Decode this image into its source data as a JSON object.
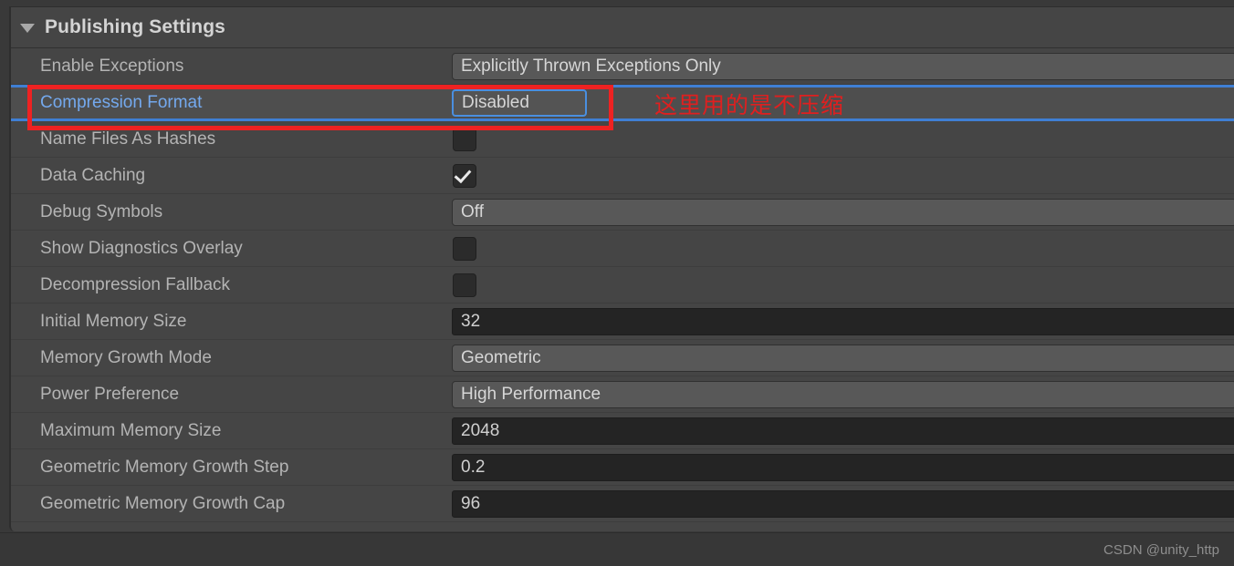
{
  "panel": {
    "foldout": {
      "title": "Publishing Settings",
      "expanded": true,
      "triangle_icon": "chevron-down-icon"
    }
  },
  "rows": [
    {
      "label": "Enable Exceptions",
      "type": "dropdown",
      "value": "Explicitly Thrown Exceptions Only",
      "modified": false,
      "selected": false
    },
    {
      "label": "Compression Format",
      "type": "dropdown",
      "value": "Disabled",
      "modified": true,
      "selected": true
    },
    {
      "label": "Name Files As Hashes",
      "type": "checkbox",
      "value": false,
      "modified": false,
      "selected": false
    },
    {
      "label": "Data Caching",
      "type": "checkbox",
      "value": true,
      "modified": false,
      "selected": false
    },
    {
      "label": "Debug Symbols",
      "type": "dropdown",
      "value": "Off",
      "modified": false,
      "selected": false
    },
    {
      "label": "Show Diagnostics Overlay",
      "type": "checkbox",
      "value": false,
      "modified": false,
      "selected": false
    },
    {
      "label": "Decompression Fallback",
      "type": "checkbox",
      "value": false,
      "modified": false,
      "selected": false
    },
    {
      "label": "Initial Memory Size",
      "type": "number",
      "value": "32",
      "modified": false,
      "selected": false
    },
    {
      "label": "Memory Growth Mode",
      "type": "dropdown",
      "value": "Geometric",
      "modified": false,
      "selected": false
    },
    {
      "label": "Power Preference",
      "type": "dropdown",
      "value": "High Performance",
      "modified": false,
      "selected": false
    },
    {
      "label": "Maximum Memory Size",
      "type": "number",
      "value": "2048",
      "modified": false,
      "selected": false
    },
    {
      "label": "Geometric Memory Growth Step",
      "type": "number",
      "value": "0.2",
      "modified": false,
      "selected": false
    },
    {
      "label": "Geometric Memory Growth Cap",
      "type": "number",
      "value": "96",
      "modified": false,
      "selected": false
    }
  ],
  "annotations": {
    "chinese_note": "这里用的是不压缩",
    "note_color": "#e01f1f",
    "highlight_box_color": "#ee2222"
  },
  "footer": {
    "watermark": "CSDN @unity_http"
  },
  "colors": {
    "panel_bg": "#454545",
    "window_bg": "#393939",
    "selected_row_bg": "#4e4e4e",
    "selection_border": "#3f7fd4",
    "modified_label": "#74a9ee",
    "label_text": "#b4b4b4",
    "dropdown_bg": "#585858",
    "number_field_bg": "#242424"
  }
}
